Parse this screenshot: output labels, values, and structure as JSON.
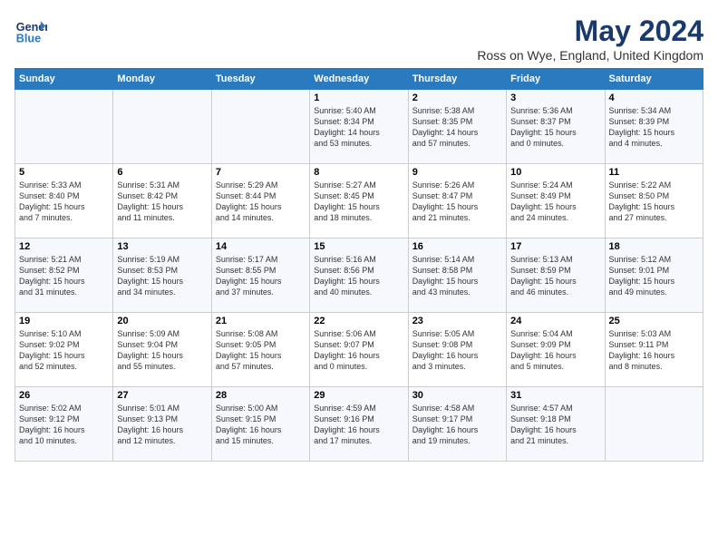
{
  "logo": {
    "text_general": "General",
    "text_blue": "Blue"
  },
  "title": "May 2024",
  "location": "Ross on Wye, England, United Kingdom",
  "headers": [
    "Sunday",
    "Monday",
    "Tuesday",
    "Wednesday",
    "Thursday",
    "Friday",
    "Saturday"
  ],
  "weeks": [
    [
      {
        "day": "",
        "info": ""
      },
      {
        "day": "",
        "info": ""
      },
      {
        "day": "",
        "info": ""
      },
      {
        "day": "1",
        "info": "Sunrise: 5:40 AM\nSunset: 8:34 PM\nDaylight: 14 hours\nand 53 minutes."
      },
      {
        "day": "2",
        "info": "Sunrise: 5:38 AM\nSunset: 8:35 PM\nDaylight: 14 hours\nand 57 minutes."
      },
      {
        "day": "3",
        "info": "Sunrise: 5:36 AM\nSunset: 8:37 PM\nDaylight: 15 hours\nand 0 minutes."
      },
      {
        "day": "4",
        "info": "Sunrise: 5:34 AM\nSunset: 8:39 PM\nDaylight: 15 hours\nand 4 minutes."
      }
    ],
    [
      {
        "day": "5",
        "info": "Sunrise: 5:33 AM\nSunset: 8:40 PM\nDaylight: 15 hours\nand 7 minutes."
      },
      {
        "day": "6",
        "info": "Sunrise: 5:31 AM\nSunset: 8:42 PM\nDaylight: 15 hours\nand 11 minutes."
      },
      {
        "day": "7",
        "info": "Sunrise: 5:29 AM\nSunset: 8:44 PM\nDaylight: 15 hours\nand 14 minutes."
      },
      {
        "day": "8",
        "info": "Sunrise: 5:27 AM\nSunset: 8:45 PM\nDaylight: 15 hours\nand 18 minutes."
      },
      {
        "day": "9",
        "info": "Sunrise: 5:26 AM\nSunset: 8:47 PM\nDaylight: 15 hours\nand 21 minutes."
      },
      {
        "day": "10",
        "info": "Sunrise: 5:24 AM\nSunset: 8:49 PM\nDaylight: 15 hours\nand 24 minutes."
      },
      {
        "day": "11",
        "info": "Sunrise: 5:22 AM\nSunset: 8:50 PM\nDaylight: 15 hours\nand 27 minutes."
      }
    ],
    [
      {
        "day": "12",
        "info": "Sunrise: 5:21 AM\nSunset: 8:52 PM\nDaylight: 15 hours\nand 31 minutes."
      },
      {
        "day": "13",
        "info": "Sunrise: 5:19 AM\nSunset: 8:53 PM\nDaylight: 15 hours\nand 34 minutes."
      },
      {
        "day": "14",
        "info": "Sunrise: 5:17 AM\nSunset: 8:55 PM\nDaylight: 15 hours\nand 37 minutes."
      },
      {
        "day": "15",
        "info": "Sunrise: 5:16 AM\nSunset: 8:56 PM\nDaylight: 15 hours\nand 40 minutes."
      },
      {
        "day": "16",
        "info": "Sunrise: 5:14 AM\nSunset: 8:58 PM\nDaylight: 15 hours\nand 43 minutes."
      },
      {
        "day": "17",
        "info": "Sunrise: 5:13 AM\nSunset: 8:59 PM\nDaylight: 15 hours\nand 46 minutes."
      },
      {
        "day": "18",
        "info": "Sunrise: 5:12 AM\nSunset: 9:01 PM\nDaylight: 15 hours\nand 49 minutes."
      }
    ],
    [
      {
        "day": "19",
        "info": "Sunrise: 5:10 AM\nSunset: 9:02 PM\nDaylight: 15 hours\nand 52 minutes."
      },
      {
        "day": "20",
        "info": "Sunrise: 5:09 AM\nSunset: 9:04 PM\nDaylight: 15 hours\nand 55 minutes."
      },
      {
        "day": "21",
        "info": "Sunrise: 5:08 AM\nSunset: 9:05 PM\nDaylight: 15 hours\nand 57 minutes."
      },
      {
        "day": "22",
        "info": "Sunrise: 5:06 AM\nSunset: 9:07 PM\nDaylight: 16 hours\nand 0 minutes."
      },
      {
        "day": "23",
        "info": "Sunrise: 5:05 AM\nSunset: 9:08 PM\nDaylight: 16 hours\nand 3 minutes."
      },
      {
        "day": "24",
        "info": "Sunrise: 5:04 AM\nSunset: 9:09 PM\nDaylight: 16 hours\nand 5 minutes."
      },
      {
        "day": "25",
        "info": "Sunrise: 5:03 AM\nSunset: 9:11 PM\nDaylight: 16 hours\nand 8 minutes."
      }
    ],
    [
      {
        "day": "26",
        "info": "Sunrise: 5:02 AM\nSunset: 9:12 PM\nDaylight: 16 hours\nand 10 minutes."
      },
      {
        "day": "27",
        "info": "Sunrise: 5:01 AM\nSunset: 9:13 PM\nDaylight: 16 hours\nand 12 minutes."
      },
      {
        "day": "28",
        "info": "Sunrise: 5:00 AM\nSunset: 9:15 PM\nDaylight: 16 hours\nand 15 minutes."
      },
      {
        "day": "29",
        "info": "Sunrise: 4:59 AM\nSunset: 9:16 PM\nDaylight: 16 hours\nand 17 minutes."
      },
      {
        "day": "30",
        "info": "Sunrise: 4:58 AM\nSunset: 9:17 PM\nDaylight: 16 hours\nand 19 minutes."
      },
      {
        "day": "31",
        "info": "Sunrise: 4:57 AM\nSunset: 9:18 PM\nDaylight: 16 hours\nand 21 minutes."
      },
      {
        "day": "",
        "info": ""
      }
    ]
  ]
}
